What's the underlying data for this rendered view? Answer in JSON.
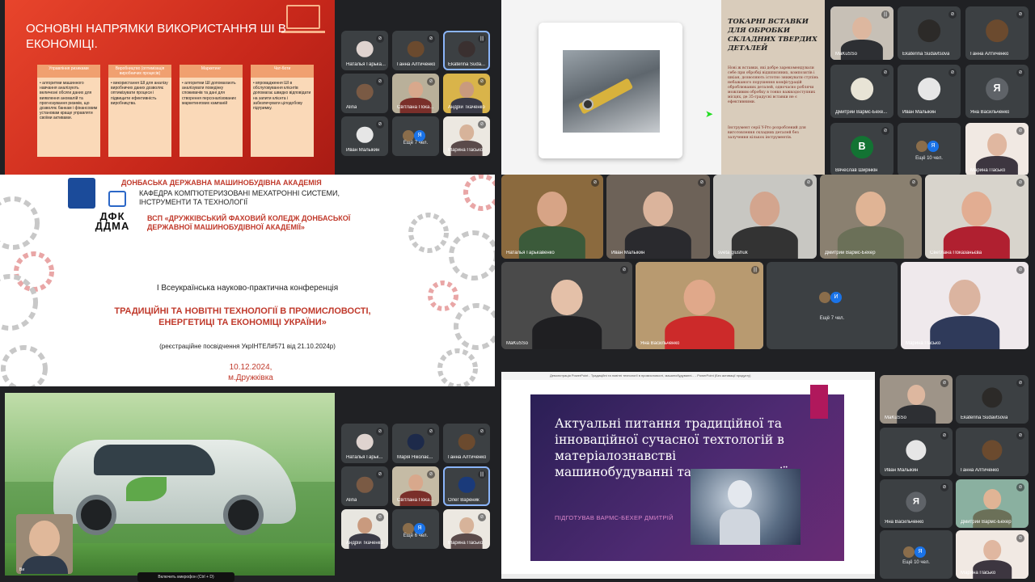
{
  "q1": {
    "slide": {
      "title": "ОСНОВНІ НАПРЯМКИ ВИКОРИСТАННЯ ШІ В ЕКОНОМІЦІ.",
      "columns": [
        {
          "head": "Управління ризиками",
          "text": "• алгоритми машинного навчання аналізують величезні обсяги даних для виявлення аномалій та прогнозування ризиків, що дозволяє банкам і фінансовим установам краще управляти своїми активами."
        },
        {
          "head": "Виробництво (оптимізація виробничих процесів)",
          "text": "• використання ШІ для аналізу виробничих даних дозволяє оптимізувати процеси і підвищити ефективність виробництва."
        },
        {
          "head": "Маркетинг",
          "text": "• алгоритми ШІ допомагають аналізувати поведінку споживачів та дані для створення персоналізованих маркетингових кампаній"
        },
        {
          "head": "Чат-боти",
          "text": "• впровадження ШІ в обслуговування клієнтів допомагає швидко відповідати на запити клієнта і забезпечувати цілодобову підтримку."
        }
      ]
    },
    "tiles": [
      "Наталья Гарька...",
      "Ганна Алтиченко",
      "Ekaterina Suda...",
      "Alina",
      "Світлана Пока...",
      "Андрій Ткаченко",
      "Иван Малыкин",
      "Ещё 7 чел.",
      "Марина Пасько"
    ]
  },
  "q2": {
    "slide": {
      "title": "ТОКАРНІ ВСТАВКИ ДЛЯ ОБРОБКИ СКЛАДНИХ ТВЕРДИХ ДЕТАЛЕЙ",
      "p1": "Нові ж вставки, які добре зарекомендували себе при обробці відшпиляних, композитів і шкіан, дозволяють істотно знижувати ступінь небажаного порушення конфігурацій оброблюваних деталей, одночасно роблячи можливим обробку в тонко важкодоступних місцях, де 35-градусні вставки не є ефективними.",
      "p2": "Інструмент серії Y-Pro розроблений для виготовлення складних деталей без залучення кількох інструментів."
    },
    "tiles": [
      "MaKuSSo",
      "Ekaterina Sudavtsova",
      "Ганна Алтиченко",
      "Дмитрий Вармс-Бехе...",
      "Иван Малыкин",
      "Яна Васильченко",
      "Вячеслав Ширінкін",
      "Ещё 10 чел.",
      "Марина Пасько"
    ],
    "avatars": {
      "ya": "Я",
      "v": "В"
    }
  },
  "q3": {
    "academy": "ДОНБАСЬКА ДЕРЖАВНА МАШИНОБУДІВНА АКАДЕМІЯ",
    "dept": "КАФЕДРА КОМП'ЮТЕРИЗОВАНІ МЕХАТРОННІ СИСТЕМИ, ІНСТРУМЕНТИ ТА ТЕХНОЛОГІЇ",
    "college": "ВСП «ДРУЖКІВСЬКИЙ ФАХОВИЙ КОЛЕДЖ ДОНБАСЬКОЇ ДЕРЖАВНОЇ МАШИНОБУДІВНОЇ АКАДЕМІЇ»",
    "logo": "ДФК ДДМА",
    "conf": "І Всеукраїнська науково-практична конференція",
    "title": "ТРАДИЦІЙНІ ТА НОВІТНІ ТЕХНОЛОГІЇ В ПРОМИСЛОВОСТІ, ЕНЕРГЕТИЦІ ТА ЕКОНОМІЦІ УКРАЇНИ»",
    "reg": "(реєстраційне посвідчення УкрІНТЕЛ#571 від 21.10.2024р)",
    "date": "10.12.2024,",
    "city": "м.Дружківка"
  },
  "q4": {
    "tiles": [
      "Наталья Гарькавенко",
      "Иван Малыкин",
      "sveta glushuk",
      "Дмитрий Вармс-Бехер",
      "Светлана Показаньєва",
      "MaKuSSo",
      "Яна Васильченко",
      "Ещё 7 чел.",
      "Марина Пасько"
    ],
    "avatar": "И"
  },
  "q5": {
    "tiles": [
      "Наталья Гарьк...",
      "Марія Ніколає...",
      "Ганна Алтиченко",
      "Alina",
      "Світлана Пока...",
      "Олег Вареник",
      "Андрій Ткаченко",
      "Ещё 6 чел.",
      "Марина Пасько"
    ],
    "self": "Ви",
    "hint": "Включить микрофон (Ctrl + D)"
  },
  "q6": {
    "window_title": "Демонстрація PowerPoint - Традиційні та новітні технології в промисловості, машинобудуванні... - PowerPoint (Без активації продукту)",
    "title": "Актуальні питання традиційної та інноваційної сучасної техтологій в матеріалознавстві машинобудуванні та автоматизації",
    "author": "ПІДГОТУВАВ ВАРМС-БЕХЕР ДМИТРІЙ",
    "tiles": [
      "MaKuSSo",
      "Ekaterina Sudavtsova",
      "Иван Малыкин",
      "Ганна Алтиченко",
      "Яна Васильченко",
      "Дмитрий Вармс-Бехер",
      "Ещё 10 чел.",
      "Марина Пасько"
    ],
    "avatar": "Я"
  }
}
